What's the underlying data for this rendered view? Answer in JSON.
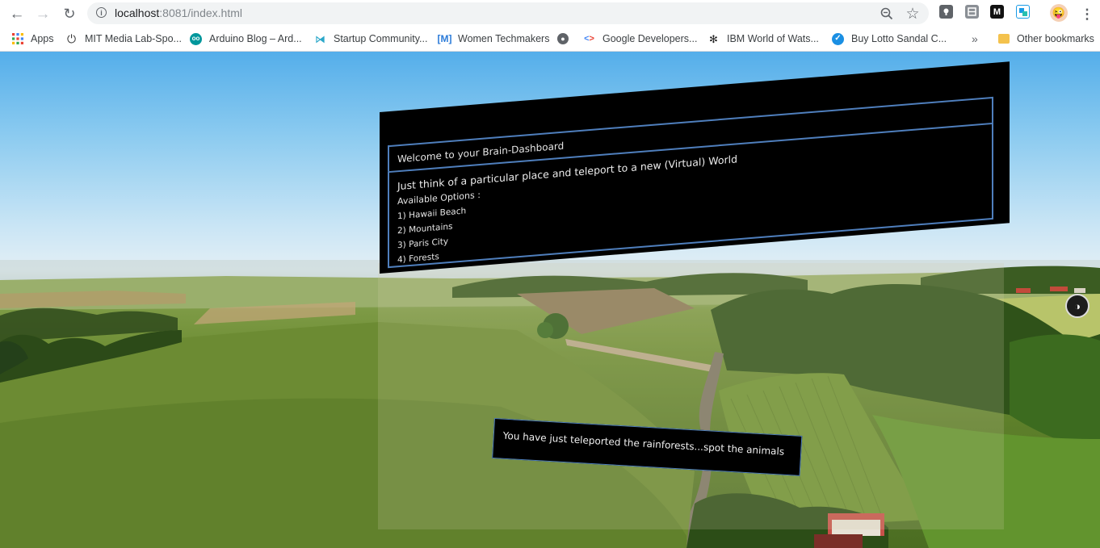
{
  "browser": {
    "url_host": "localhost",
    "url_rest": ":8081/index.html",
    "bookmarks": [
      {
        "label": "Apps",
        "icon": "apps-grid-icon"
      },
      {
        "label": "MIT Media Lab-Spo...",
        "icon": "power-icon"
      },
      {
        "label": "Arduino Blog – Ard...",
        "icon": "arduino-icon"
      },
      {
        "label": "Startup Community...",
        "icon": "startup-icon"
      },
      {
        "label": "Women Techmakers",
        "icon": "women-techmakers-icon"
      },
      {
        "label": "",
        "icon": "globe-icon"
      },
      {
        "label": "Google Developers...",
        "icon": "google-developers-icon"
      },
      {
        "label": "IBM World of Wats...",
        "icon": "ibm-watson-icon"
      },
      {
        "label": "Buy Lotto Sandal C...",
        "icon": "check-circle-icon"
      }
    ],
    "overflow_label": "»",
    "other_bookmarks": "Other bookmarks",
    "extensions": [
      {
        "label": "",
        "icon": "extension-shield-icon"
      },
      {
        "label": "",
        "icon": "extension-puzzle-icon"
      },
      {
        "label": "M",
        "icon": "medium-icon"
      },
      {
        "label": "",
        "icon": "extension-translate-icon"
      }
    ]
  },
  "dashboard": {
    "title": "Welcome to your Brain-Dashboard",
    "intro": "Just think of a particular place and teleport to a new (Virtual) World",
    "options_label": "Available Options :",
    "options": [
      "1) Hawaii Beach",
      "2) Mountains",
      "3) Paris City",
      "4) Forests"
    ]
  },
  "notice": {
    "text": "You have just teleported the rainforests...spot the animals"
  },
  "colors": {
    "panel_border": "#4f7fbd",
    "panel_bg": "#000000",
    "chrome_bg": "#ffffff"
  }
}
